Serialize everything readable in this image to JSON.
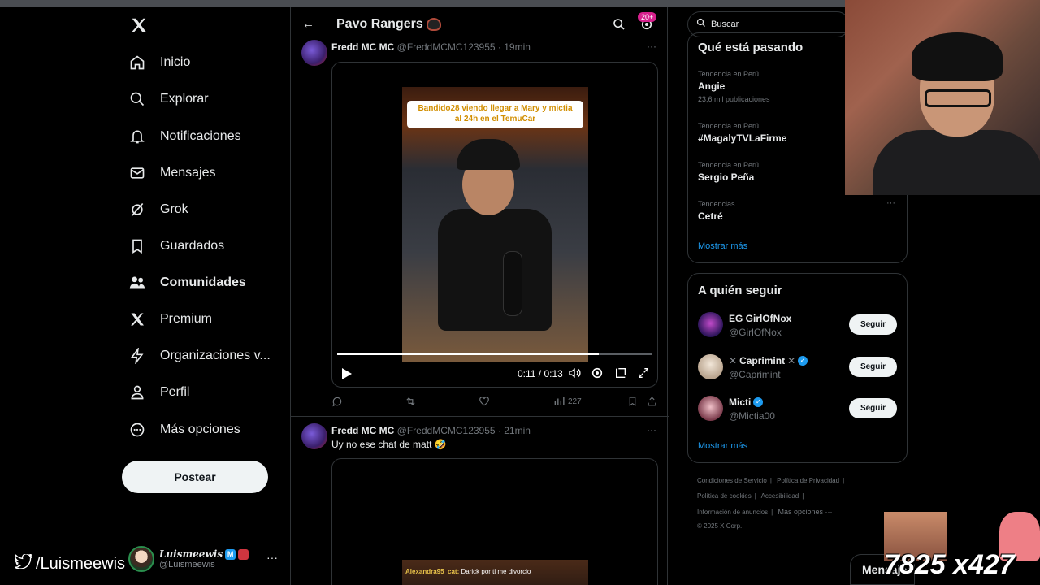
{
  "nav": {
    "items": [
      {
        "label": "Inicio",
        "icon": "home-icon"
      },
      {
        "label": "Explorar",
        "icon": "search-icon"
      },
      {
        "label": "Notificaciones",
        "icon": "bell-icon"
      },
      {
        "label": "Mensajes",
        "icon": "mail-icon"
      },
      {
        "label": "Grok",
        "icon": "grok-icon"
      },
      {
        "label": "Guardados",
        "icon": "bookmark-icon"
      },
      {
        "label": "Comunidades",
        "icon": "communities-icon"
      },
      {
        "label": "Premium",
        "icon": "x-logo-icon"
      },
      {
        "label": "Organizaciones v...",
        "icon": "lightning-icon"
      },
      {
        "label": "Perfil",
        "icon": "person-icon"
      },
      {
        "label": "Más opciones",
        "icon": "more-circle-icon"
      }
    ],
    "post_label": "Postear"
  },
  "account": {
    "name": "Luismeewis",
    "badge_m": "M",
    "handle": "@Luismeewis",
    "more": "···"
  },
  "watermark": "/Luismeewis",
  "community": {
    "title": "Pavo Rangers",
    "notif_count": "20+"
  },
  "tweets": [
    {
      "name": "Fredd MC MC",
      "handle": "@FreddMCMC123955 · 19min",
      "video_caption_line1": "Bandido28 viendo llegar a Mary y mictia",
      "video_caption_line2": "al 24h en el TemuCar",
      "time": "0:11 / 0:13",
      "progress": 0.83,
      "views": "227"
    },
    {
      "name": "Fredd MC MC",
      "handle": "@FreddMCMC123955 · 21min",
      "text": "Uy no ese chat de matt 🤣",
      "chat_user": "Alexandra95_cat:",
      "chat_msg": " Darick por ti me divorcio"
    }
  ],
  "right": {
    "search_placeholder": "Buscar",
    "trends_title": "Qué está pasando",
    "trends": [
      {
        "context": "Tendencia en Perú",
        "name": "Angie",
        "count": "23,6 mil publicaciones"
      },
      {
        "context": "Tendencia en Perú",
        "name": "#MagalyTVLaFirme",
        "count": ""
      },
      {
        "context": "Tendencia en Perú",
        "name": "Sergio Peña",
        "count": ""
      },
      {
        "context": "Tendencias",
        "name": "Cetré",
        "count": ""
      }
    ],
    "trends_more": "Mostrar más",
    "follow_title": "A quién seguir",
    "follows": [
      {
        "name": "EG GirlOfNox",
        "handle": "@GirlOfNox",
        "button": "Seguir",
        "verified": false
      },
      {
        "name": "Caprimint",
        "handle": "@Caprimint",
        "button": "Seguir",
        "verified": true
      },
      {
        "name": "Micti",
        "handle": "@Mictia00",
        "button": "Seguir",
        "verified": true
      }
    ],
    "follow_more": "Mostrar más",
    "footer": {
      "terms": "Condiciones de Servicio",
      "privacy": "Política de Privacidad",
      "cookies": "Política de cookies",
      "access": "Accesibilidad",
      "ads": "Información de anuncios",
      "more": "Más opciones ···",
      "copyright": "© 2025 X Corp."
    }
  },
  "overlay": {
    "counter": "7825 x427",
    "dm_label": "Mensajes"
  },
  "colors": {
    "accent": "#1d9bf0",
    "background": "#000000",
    "border": "#2f3336",
    "caption_text": "#d18e00"
  }
}
